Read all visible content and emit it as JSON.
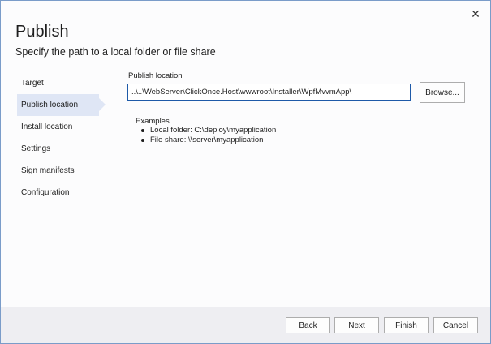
{
  "dialog": {
    "title": "Publish",
    "subtitle": "Specify the path to a local folder or file share"
  },
  "nav": {
    "items": [
      {
        "label": "Target"
      },
      {
        "label": "Publish location"
      },
      {
        "label": "Install location"
      },
      {
        "label": "Settings"
      },
      {
        "label": "Sign manifests"
      },
      {
        "label": "Configuration"
      }
    ],
    "active_index": 1
  },
  "publish_location": {
    "label": "Publish location",
    "value": "..\\..\\WebServer\\ClickOnce.Host\\wwwroot\\Installer\\WpfMvvmApp\\",
    "browse_label": "Browse..."
  },
  "examples": {
    "title": "Examples",
    "items": [
      "Local folder:  C:\\deploy\\myapplication",
      "File share: \\\\server\\myapplication"
    ]
  },
  "footer": {
    "back_label": "Back",
    "next_label": "Next",
    "finish_label": "Finish",
    "cancel_label": "Cancel"
  }
}
